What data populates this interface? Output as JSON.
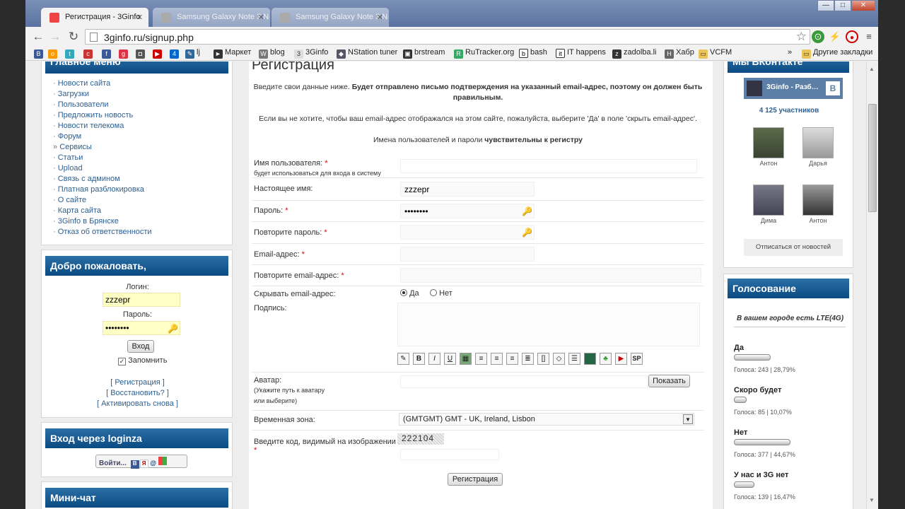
{
  "browser": {
    "tabs": [
      {
        "title": "Регистрация - 3Ginfo"
      },
      {
        "title": "Samsung Galaxy Note 3 N"
      },
      {
        "title": "Samsung Galaxy Note 3 N"
      }
    ],
    "url": "3ginfo.ru/signup.php",
    "bookmarks": [
      "Маркет",
      "blog",
      "3Ginfo",
      "NStation tuner",
      "brstream",
      "RuTracker.org",
      "bash",
      "IT happens",
      "zadolba.li",
      "Хабр",
      "VCFM"
    ],
    "bookmarks_short": [
      "lj"
    ],
    "other_bookmarks": "Другие закладки",
    "overflow": "»"
  },
  "sidebar": {
    "main_menu_title": "Главное меню",
    "menu_items": [
      "Новости сайта",
      "Загрузки",
      "Пользователи",
      "Предложить новость",
      "Новости телекома",
      "Форум",
      "Сервисы",
      "Статьи",
      "Upload",
      "Связь с админом",
      "Платная разблокировка",
      "О сайте",
      "Карта сайта",
      "3Ginfo в Брянске",
      "Отказ об ответственности"
    ],
    "welcome_title": "Добро пожаловать,",
    "login_label": "Логин:",
    "login_value": "zzzepr",
    "password_label": "Пароль:",
    "password_value": "••••••••",
    "enter_button": "Вход",
    "remember_label": "Запомнить",
    "link_register": "[ Регистрация ]",
    "link_restore": "[ Восстановить? ]",
    "link_activate": "[ Активировать снова ]",
    "loginza_title": "Вход через loginza",
    "loginza_button": "Войти...",
    "minichat_title": "Мини-чат"
  },
  "form": {
    "title": "Регистрация",
    "intro_plain": "Введите свои данные ниже.",
    "intro_bold": "Будет отправлено письмо подтверждения на указанный email-адрес, поэтому он должен быть правильным.",
    "hide_note": "Если вы не хотите, чтобы ваш email-адрес отображался на этом сайте, пожалуйста, выберите 'Да' в поле 'скрыть email-адрес'.",
    "case_plain": "Имена пользователей и пароли",
    "case_bold": "чувствительны к регистру",
    "username_label": "Имя пользователя:",
    "username_hint": "будет использоваться для входа в систему",
    "realname_label": "Настоящее имя:",
    "realname_value": "zzzepr",
    "password_label": "Пароль:",
    "password_value": "••••••••",
    "password2_label": "Повторите пароль:",
    "email_label": "Email-адрес:",
    "email2_label": "Повторите email-адрес:",
    "hide_email_label": "Скрывать email-адрес:",
    "yes": "Да",
    "no": "Нет",
    "signature_label": "Подпись:",
    "avatar_label": "Аватар:",
    "avatar_hint1": "(Укажите путь к аватару",
    "avatar_hint2": "или выберите)",
    "show_button": "Показать",
    "timezone_label": "Временная зона:",
    "timezone_value": "(GMTGMT) GMT - UK, Ireland, Lisbon",
    "captcha_label": "Введите код, видимый на изображении",
    "captcha_code": "222104",
    "submit_button": "Регистрация",
    "req_mark": "*"
  },
  "right": {
    "vk_title": "Мы ВКонтакте",
    "vk_group": "3Ginfo - Разб…",
    "vk_members": "4 125 участников",
    "members": [
      "Антон",
      "Дарья",
      "Дима",
      "Антон"
    ],
    "unsubscribe": "Отписаться от новостей",
    "poll_title": "Голосование",
    "poll_question": "В вашем городе есть LTE(4G)",
    "poll": [
      {
        "label": "Да",
        "stat": "Голоса: 243 | 28,79%",
        "pct": 28.79
      },
      {
        "label": "Скоро будет",
        "stat": "Голоса: 85 | 10,07%",
        "pct": 10.07
      },
      {
        "label": "Нет",
        "stat": "Голоса: 377 | 44,67%",
        "pct": 44.67
      },
      {
        "label": "У нас и 3G нет",
        "stat": "Голоса: 139 | 16,47%",
        "pct": 16.47
      }
    ]
  },
  "colors": {
    "header_blue": "#0b4a82",
    "link_blue": "#2c5f92",
    "input_yellow": "#ffffc6",
    "required": "#dd0000"
  }
}
